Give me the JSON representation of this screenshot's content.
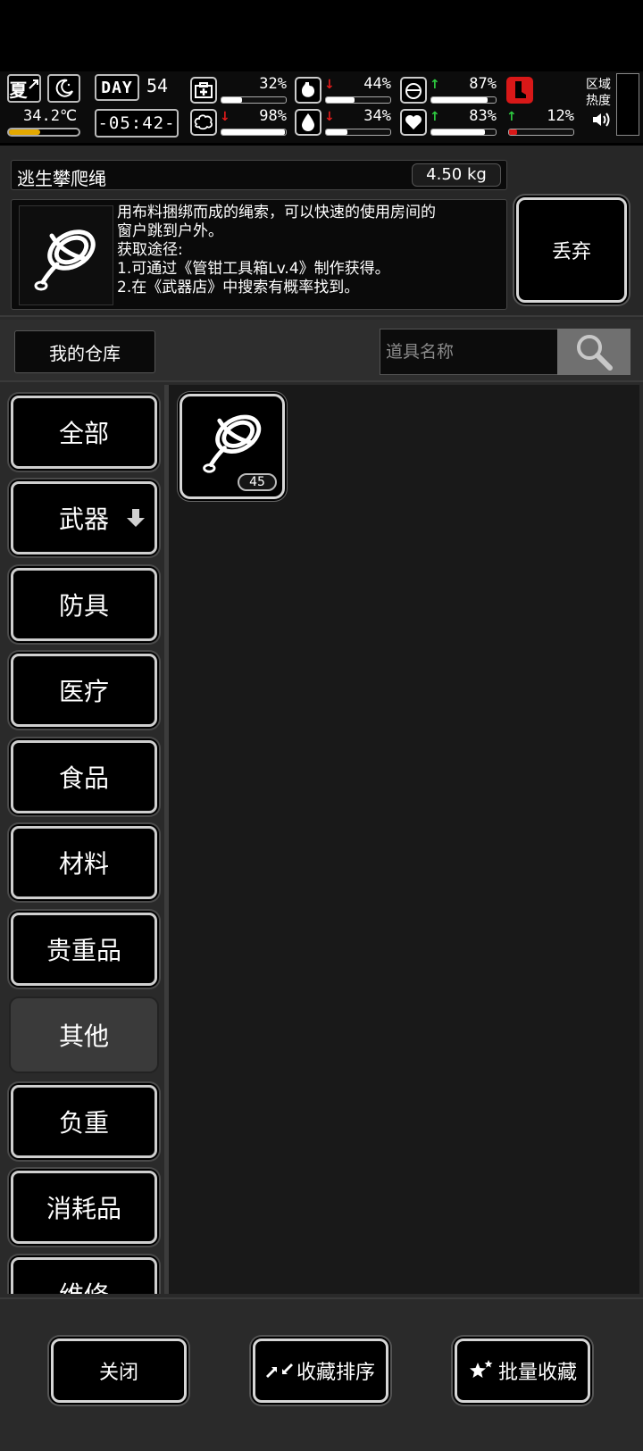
{
  "status": {
    "season": "夏",
    "temperature": "34.2℃",
    "temperature_level": 0.45,
    "day_label": "DAY",
    "day_number": "54",
    "time": "-05:42-",
    "stats": [
      {
        "name": "health",
        "icon": "first-aid-icon",
        "arrow": "",
        "value": "32%",
        "fill": 0.32
      },
      {
        "name": "hunger",
        "icon": "stomach-icon",
        "arrow": "down",
        "value": "44%",
        "fill": 0.44
      },
      {
        "name": "stamina",
        "icon": "lungs-icon",
        "arrow": "up",
        "value": "87%",
        "fill": 0.87
      },
      {
        "name": "brain",
        "icon": "brain-icon",
        "arrow": "down",
        "value": "98%",
        "fill": 0.98
      },
      {
        "name": "thirst",
        "icon": "water-drop-icon",
        "arrow": "down",
        "value": "34%",
        "fill": 0.34
      },
      {
        "name": "mood",
        "icon": "heart-icon",
        "arrow": "up",
        "value": "83%",
        "fill": 0.83
      },
      {
        "name": "load",
        "icon": "boot-icon",
        "arrow": "up",
        "value": "12%",
        "fill": 0.12
      }
    ],
    "area_heat_label": "区域热度"
  },
  "item": {
    "name": "逃生攀爬绳",
    "weight": "4.50 kg",
    "description_lines": [
      "用布料捆绑而成的绳索，可以快速的使用房间的",
      "窗户跳到户外。",
      "获取途径:",
      "1.可通过《管钳工具箱Lv.4》制作获得。",
      "2.在《武器店》中搜索有概率找到。"
    ],
    "discard_label": "丢弃"
  },
  "warehouse": {
    "label": "我的仓库",
    "search_placeholder": "道具名称"
  },
  "categories": [
    {
      "label": "全部",
      "active": false
    },
    {
      "label": "武器",
      "active": false,
      "has_arrow": true
    },
    {
      "label": "防具",
      "active": false
    },
    {
      "label": "医疗",
      "active": false
    },
    {
      "label": "食品",
      "active": false
    },
    {
      "label": "材料",
      "active": false
    },
    {
      "label": "贵重品",
      "active": false
    },
    {
      "label": "其他",
      "active": true
    },
    {
      "label": "负重",
      "active": false
    },
    {
      "label": "消耗品",
      "active": false
    },
    {
      "label": "维修",
      "active": false
    }
  ],
  "inventory": [
    {
      "icon": "rope-icon",
      "count": "45"
    }
  ],
  "bottom": {
    "close_label": "关闭",
    "sort_label": "收藏排序",
    "batch_label": "批量收藏"
  },
  "colors": {
    "accent_up": "#2ecc40",
    "accent_down": "#e21b1b",
    "temp_bar": "#e3a800"
  }
}
